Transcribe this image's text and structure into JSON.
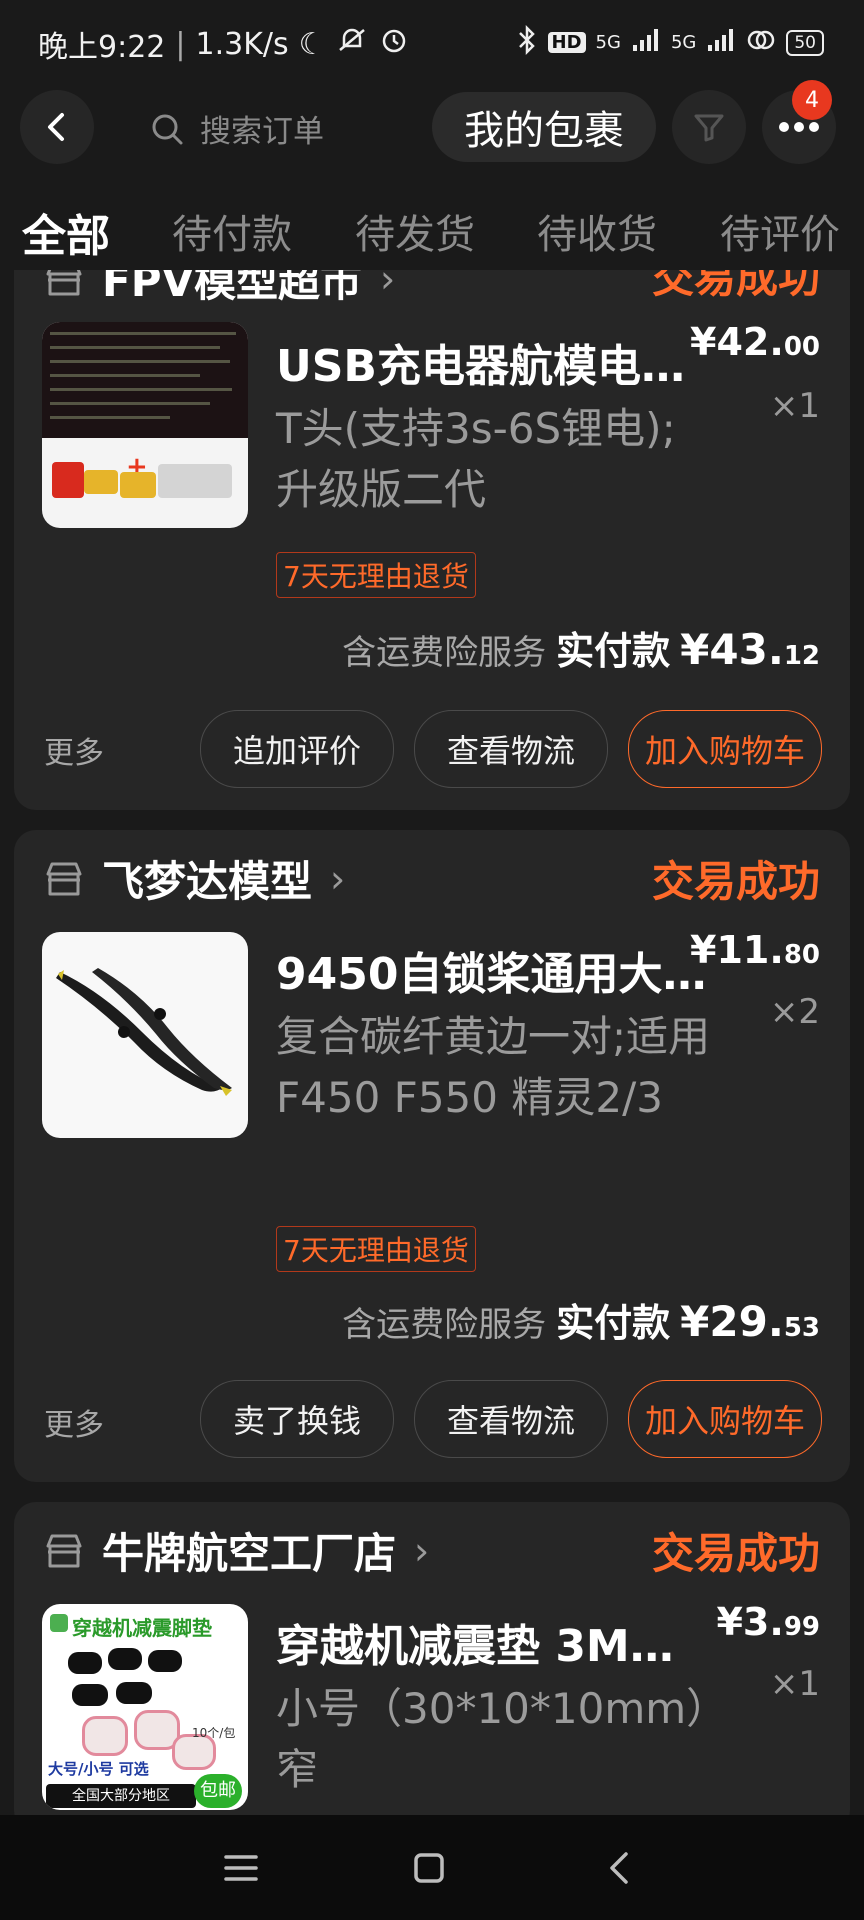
{
  "status_bar": {
    "time": "晚上9:22",
    "speed": "1.3K/s",
    "signal1": "5G",
    "signal2": "5G",
    "hd": "HD",
    "battery": "50"
  },
  "header": {
    "search_placeholder": "搜索订单",
    "parcel_label": "我的包裹",
    "notification_count": "4"
  },
  "tabs": [
    {
      "label": "全部",
      "active": true
    },
    {
      "label": "待付款"
    },
    {
      "label": "待发货"
    },
    {
      "label": "待收货"
    },
    {
      "label": "待评价"
    }
  ],
  "orders": [
    {
      "shop": "FPV模型超市",
      "status": "交易成功",
      "title": "USB充电器航模电…",
      "price_main": "¥42.",
      "price_cents": "00",
      "qty": "×1",
      "spec": "T头(支持3s-6S锂电);升级版二代",
      "tag": "7天无理由退货",
      "insurance": "含运费险服务",
      "pay_label": "实付款",
      "pay_main": "¥43.",
      "pay_cents": "12",
      "more": "更多",
      "buttons": [
        "追加评价",
        "查看物流",
        "加入购物车"
      ]
    },
    {
      "shop": "飞梦达模型",
      "status": "交易成功",
      "title": "9450自锁桨通用大…",
      "price_main": "¥11.",
      "price_cents": "80",
      "qty": "×2",
      "spec": "复合碳纤黄边一对;适用F450 F550 精灵2/3",
      "tag": "7天无理由退货",
      "insurance": "含运费险服务",
      "pay_label": "实付款",
      "pay_main": "¥29.",
      "pay_cents": "53",
      "more": "更多",
      "buttons": [
        "卖了换钱",
        "查看物流",
        "加入购物车"
      ]
    },
    {
      "shop": "牛牌航空工厂店",
      "status": "交易成功",
      "title": "穿越机减震垫 3M…",
      "price_main": "¥3.",
      "price_cents": "99",
      "qty": "×1",
      "spec": "小号（30*10*10mm）窄"
    }
  ],
  "thumb_text": {
    "img3_title": "穿越机减震脚垫",
    "img3_size": "大号/小号 可选",
    "img3_region": "全国大部分地区",
    "img3_free": "包邮",
    "img3_pack": "10个/包"
  }
}
